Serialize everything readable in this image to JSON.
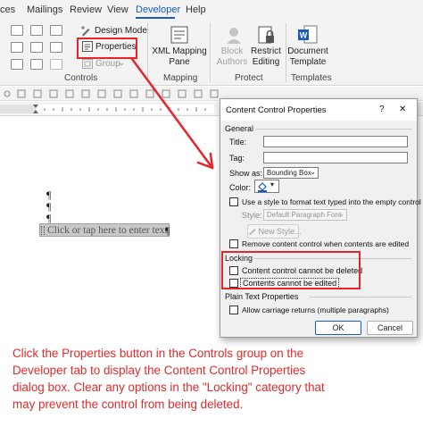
{
  "ribbon": {
    "tabs": [
      {
        "label": "ces"
      },
      {
        "label": "Mailings"
      },
      {
        "label": "Review"
      },
      {
        "label": "View"
      },
      {
        "label": "Developer"
      },
      {
        "label": "Help"
      }
    ],
    "controls": {
      "design_mode": "Design Mode",
      "properties": "Properties",
      "group": "Group",
      "label": "Controls"
    },
    "mapping": {
      "button_line1": "XML Mapping",
      "button_line2": "Pane",
      "label": "Mapping"
    },
    "protect": {
      "block_line1": "Block",
      "block_line2": "Authors",
      "restrict_line1": "Restrict",
      "restrict_line2": "Editing",
      "label": "Protect"
    },
    "templates": {
      "button_line1": "Document",
      "button_line2": "Template",
      "label": "Templates"
    }
  },
  "document": {
    "placeholder_text": "Click or tap here to enter text.",
    "paragraph_mark": "¶"
  },
  "dialog": {
    "title": "Content Control Properties",
    "help": "?",
    "close": "✕",
    "general": {
      "label": "General",
      "title_label": "Title:",
      "title_value": "",
      "tag_label": "Tag:",
      "tag_value": "",
      "show_as_label": "Show as:",
      "show_as_value": "Bounding Box",
      "color_label": "Color:",
      "use_style_label": "Use a style to format text typed into the empty control",
      "style_label": "Style:",
      "style_value": "Default Paragraph Font",
      "new_style": "New Style...",
      "remove_label": "Remove content control when contents are edited"
    },
    "locking": {
      "label": "Locking",
      "cannot_delete": "Content control cannot be deleted",
      "cannot_edit": "Contents cannot be edited"
    },
    "plain_text": {
      "label": "Plain Text Properties",
      "allow_returns": "Allow carriage returns (multiple paragraphs)"
    },
    "ok": "OK",
    "cancel": "Cancel"
  },
  "caption": {
    "lines": [
      "Click  the Properties button in the Controls group on the",
      "Developer tab to display the  Content Control Properties",
      "dialog box. Clear any options in the \"Locking\" category that",
      "may prevent the control from being deleted."
    ]
  },
  "colors": {
    "accent": "#185abd",
    "annotation_red": "#e8232a"
  }
}
